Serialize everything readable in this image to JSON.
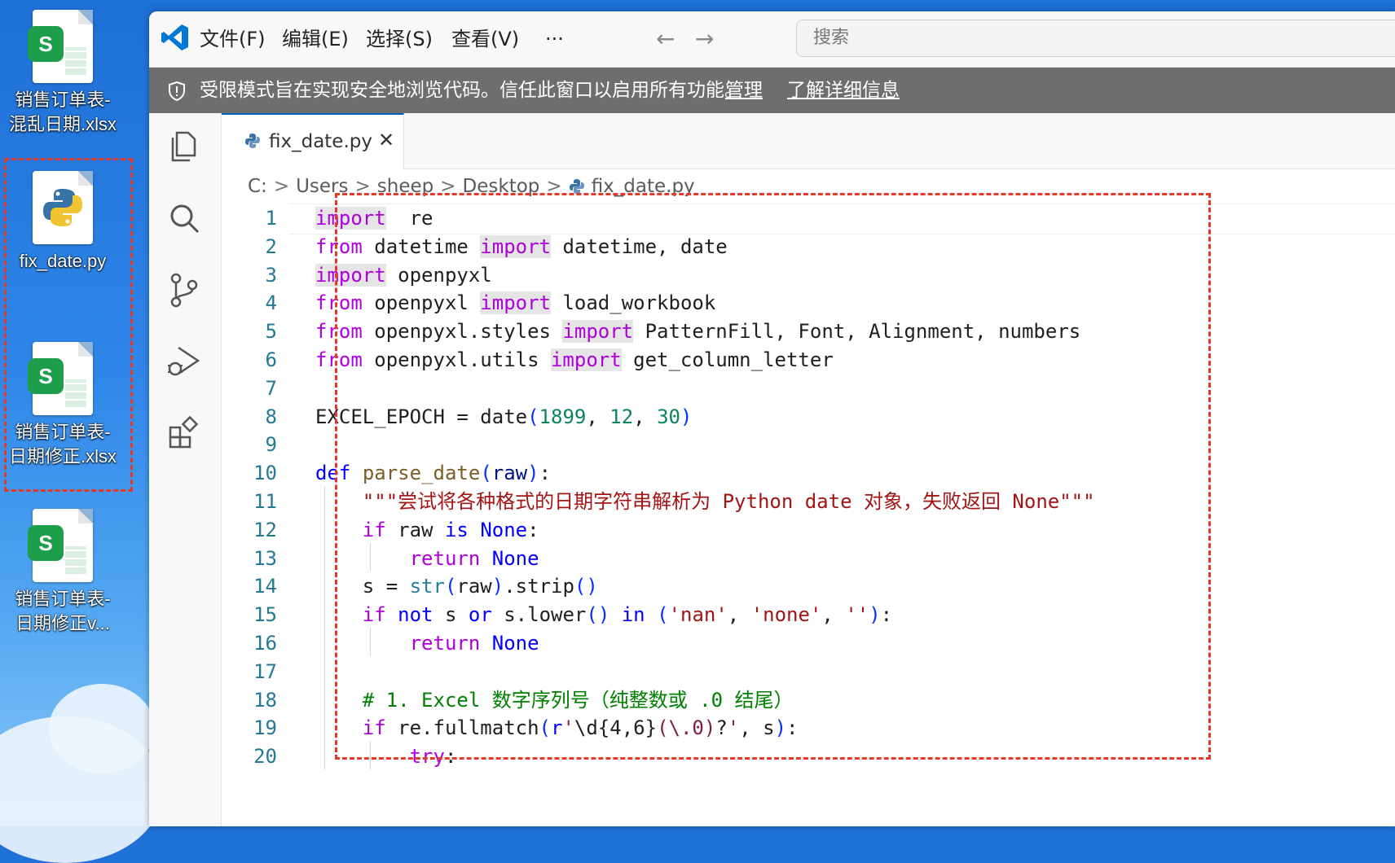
{
  "desktop": {
    "icons": [
      {
        "label1": "销售订单表-",
        "label2": "混乱日期.xlsx",
        "type": "excel",
        "badge": "S"
      },
      {
        "label1": "fix_date.py",
        "label2": "",
        "type": "python"
      },
      {
        "label1": "销售订单表-",
        "label2": "日期修正.xlsx",
        "type": "excel",
        "badge": "S"
      },
      {
        "label1": "销售订单表-",
        "label2": "日期修正v...",
        "type": "excel",
        "badge": "S"
      }
    ],
    "selection_color": "#e23a2a"
  },
  "titlebar": {
    "menus": [
      "文件(F)",
      "编辑(E)",
      "选择(S)",
      "查看(V)",
      "···"
    ],
    "back_icon": "←",
    "forward_icon": "→",
    "search_placeholder": "搜索"
  },
  "banner": {
    "message": "受限模式旨在实现安全地浏览代码。信任此窗口以启用所有功能。",
    "link_manage": "管理",
    "link_learn": "了解详细信息",
    "background": "#6e6e6e"
  },
  "activity_bar": [
    "explorer-icon",
    "search-icon",
    "source-control-icon",
    "run-debug-icon",
    "extensions-icon"
  ],
  "tab": {
    "label": "fix_date.py",
    "close": "✕",
    "accent": "#005fb8"
  },
  "breadcrumb": {
    "items": [
      "C:",
      "Users",
      "sheep",
      "Desktop",
      "fix_date.py"
    ],
    "sep": ">"
  },
  "code": {
    "active_line": 1,
    "lines": [
      [
        [
          "kwp hl",
          "import"
        ],
        [
          "",
          "  re"
        ]
      ],
      [
        [
          "kwp",
          "from"
        ],
        [
          "",
          " datetime "
        ],
        [
          "kwp hl",
          "import"
        ],
        [
          "",
          " datetime, date"
        ]
      ],
      [
        [
          "kwp hl",
          "import"
        ],
        [
          "",
          " openpyxl"
        ]
      ],
      [
        [
          "kwp",
          "from"
        ],
        [
          "",
          " openpyxl "
        ],
        [
          "kwp hl",
          "import"
        ],
        [
          "",
          " load_workbook"
        ]
      ],
      [
        [
          "kwp",
          "from"
        ],
        [
          "",
          " openpyxl.styles "
        ],
        [
          "kwp hl",
          "import"
        ],
        [
          "",
          " PatternFill, Font, Alignment, numbers"
        ]
      ],
      [
        [
          "kwp",
          "from"
        ],
        [
          "",
          " openpyxl.utils "
        ],
        [
          "kwp hl",
          "import"
        ],
        [
          "",
          " get_column_letter"
        ]
      ],
      [],
      [
        [
          "",
          "EXCEL_EPOCH = date"
        ],
        [
          "b1",
          "("
        ],
        [
          "num",
          "1899"
        ],
        [
          "",
          ", "
        ],
        [
          "num",
          "12"
        ],
        [
          "",
          ", "
        ],
        [
          "num",
          "30"
        ],
        [
          "b1",
          ")"
        ]
      ],
      [],
      [
        [
          "kw",
          "def"
        ],
        [
          "",
          " "
        ],
        [
          "fn",
          "parse_date"
        ],
        [
          "b1",
          "("
        ],
        [
          "pr",
          "raw"
        ],
        [
          "b1",
          ")"
        ],
        [
          "",
          ":"
        ]
      ],
      [
        [
          "",
          "    "
        ],
        [
          "str",
          "\"\"\"尝试将各种格式的日期字符串解析为 Python date 对象，失败返回 None\"\"\""
        ]
      ],
      [
        [
          "",
          "    "
        ],
        [
          "kwp",
          "if"
        ],
        [
          "",
          " raw "
        ],
        [
          "kw",
          "is"
        ],
        [
          "",
          " "
        ],
        [
          "kw",
          "None"
        ],
        [
          "",
          ":"
        ]
      ],
      [
        [
          "",
          "        "
        ],
        [
          "kwp",
          "return"
        ],
        [
          "",
          " "
        ],
        [
          "kw",
          "None"
        ]
      ],
      [
        [
          "",
          "    s = "
        ],
        [
          "tp",
          "str"
        ],
        [
          "b1",
          "("
        ],
        [
          "",
          "raw"
        ],
        [
          "b1",
          ")"
        ],
        [
          "",
          ".strip"
        ],
        [
          "b1",
          "()"
        ]
      ],
      [
        [
          "",
          "    "
        ],
        [
          "kwp",
          "if"
        ],
        [
          "",
          " "
        ],
        [
          "kw",
          "not"
        ],
        [
          "",
          " s "
        ],
        [
          "kw",
          "or"
        ],
        [
          "",
          " s.lower"
        ],
        [
          "b1",
          "()"
        ],
        [
          "",
          " "
        ],
        [
          "kw",
          "in"
        ],
        [
          "",
          " "
        ],
        [
          "b1",
          "("
        ],
        [
          "str",
          "'nan'"
        ],
        [
          "",
          ", "
        ],
        [
          "str",
          "'none'"
        ],
        [
          "",
          ", "
        ],
        [
          "str",
          "''"
        ],
        [
          "b1",
          ")"
        ],
        [
          "",
          ":"
        ]
      ],
      [
        [
          "",
          "        "
        ],
        [
          "kwp",
          "return"
        ],
        [
          "",
          " "
        ],
        [
          "kw",
          "None"
        ]
      ],
      [],
      [
        [
          "",
          "    "
        ],
        [
          "cm",
          "# 1. Excel 数字序列号（纯整数或 .0 结尾）"
        ]
      ],
      [
        [
          "",
          "    "
        ],
        [
          "kwp",
          "if"
        ],
        [
          "",
          " re.fullmatch"
        ],
        [
          "b1",
          "("
        ],
        [
          "kw",
          "r"
        ],
        [
          "rx",
          "'"
        ],
        [
          "",
          "\\d{4,6}"
        ],
        [
          "rx",
          "(\\.0)"
        ],
        [
          "",
          "?"
        ],
        [
          "rx",
          "'"
        ],
        [
          "",
          ", s"
        ],
        [
          "b1",
          ")"
        ],
        [
          "",
          ":"
        ]
      ],
      [
        [
          "",
          "        "
        ],
        [
          "kwp",
          "try"
        ],
        [
          "",
          ":"
        ]
      ]
    ]
  },
  "code_selection_color": "#e23a2a"
}
